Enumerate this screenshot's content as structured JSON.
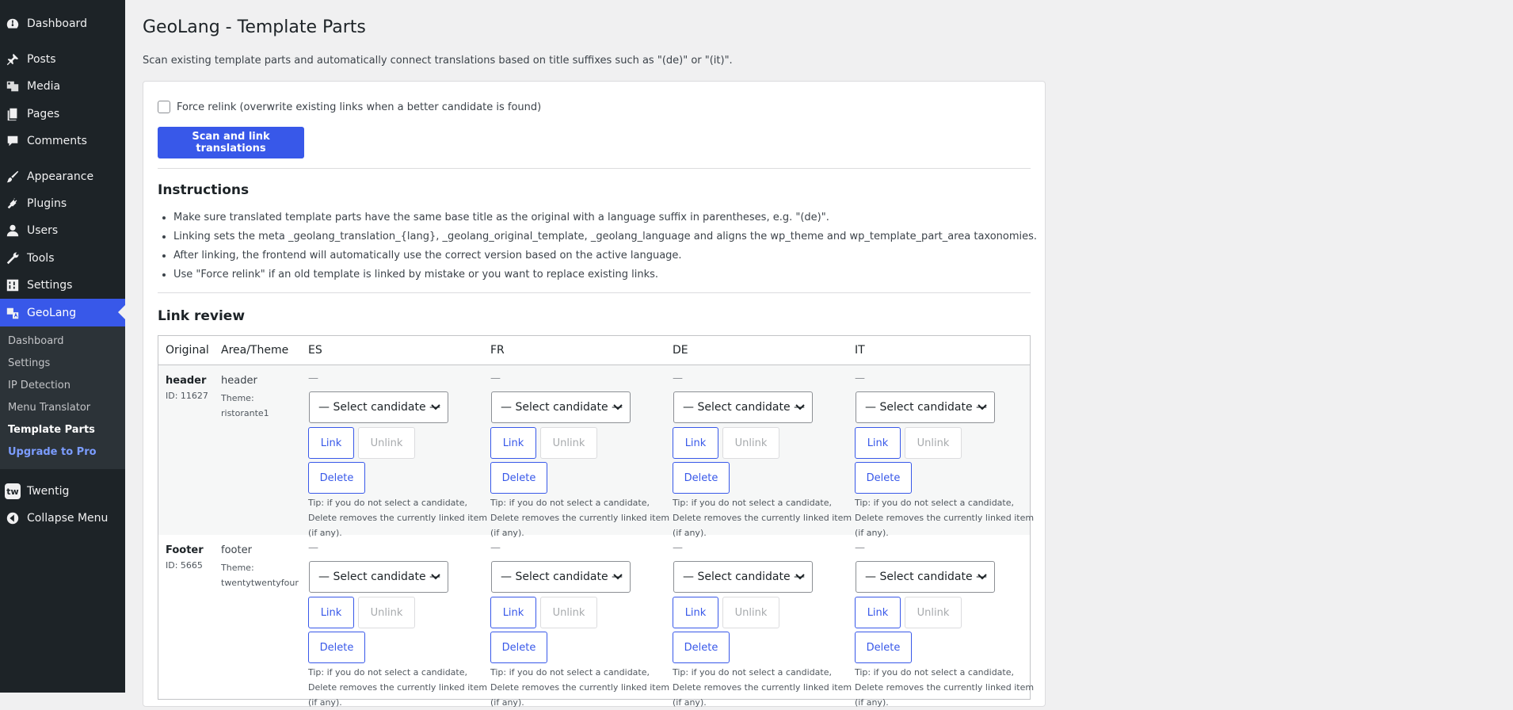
{
  "sidebar": {
    "items": [
      {
        "label": "Dashboard",
        "icon": "dashboard-icon"
      },
      {
        "label": "Posts",
        "icon": "pin-icon"
      },
      {
        "label": "Media",
        "icon": "media-icon"
      },
      {
        "label": "Pages",
        "icon": "pages-icon"
      },
      {
        "label": "Comments",
        "icon": "comment-icon"
      },
      {
        "label": "Appearance",
        "icon": "brush-icon"
      },
      {
        "label": "Plugins",
        "icon": "plug-icon"
      },
      {
        "label": "Users",
        "icon": "user-icon"
      },
      {
        "label": "Tools",
        "icon": "wrench-icon"
      },
      {
        "label": "Settings",
        "icon": "settings-icon"
      },
      {
        "label": "GeoLang",
        "icon": "translate-icon"
      }
    ],
    "submenu": [
      "Dashboard",
      "Settings",
      "IP Detection",
      "Menu Translator",
      "Template Parts",
      "Upgrade to Pro"
    ],
    "twentig": {
      "label": "Twentig",
      "badge": "tw"
    },
    "collapse": "Collapse Menu"
  },
  "page": {
    "title": "GeoLang - Template Parts",
    "description": "Scan existing template parts and automatically connect translations based on title suffixes such as \"(de)\" or \"(it)\"."
  },
  "form": {
    "force_relink_label": "Force relink (overwrite existing links when a better candidate is found)",
    "force_relink_checked": false,
    "scan_button": "Scan and link translations"
  },
  "instructions": {
    "title": "Instructions",
    "items": [
      "Make sure translated template parts have the same base title as the original with a language suffix in parentheses, e.g. \"(de)\".",
      "Linking sets the meta _geolang_translation_{lang}, _geolang_original_template, _geolang_language and aligns the wp_theme and wp_template_part_area taxonomies.",
      "After linking, the frontend will automatically use the correct version based on the active language.",
      "Use \"Force relink\" if an old template is linked by mistake or you want to replace existing links."
    ]
  },
  "review": {
    "title": "Link review",
    "headers": [
      "Original",
      "Area/Theme",
      "ES",
      "FR",
      "DE",
      "IT"
    ],
    "rows": [
      {
        "name": "header",
        "id": "ID: 11627",
        "area": "header",
        "theme": "Theme: ristorante1",
        "langs": [
          {
            "current": "—",
            "select": "— Select candidate —",
            "link": "Link",
            "unlink": "Unlink",
            "delete": "Delete",
            "tip": "Tip: if you do not select a candidate, Delete removes the currently linked item (if any)."
          },
          {
            "current": "—",
            "select": "— Select candidate —",
            "link": "Link",
            "unlink": "Unlink",
            "delete": "Delete",
            "tip": "Tip: if you do not select a candidate, Delete removes the currently linked item (if any)."
          },
          {
            "current": "—",
            "select": "— Select candidate —",
            "link": "Link",
            "unlink": "Unlink",
            "delete": "Delete",
            "tip": "Tip: if you do not select a candidate, Delete removes the currently linked item (if any)."
          },
          {
            "current": "—",
            "select": "— Select candidate —",
            "link": "Link",
            "unlink": "Unlink",
            "delete": "Delete",
            "tip": "Tip: if you do not select a candidate, Delete removes the currently linked item (if any)."
          }
        ]
      },
      {
        "name": "Footer",
        "id": "ID: 5665",
        "area": "footer",
        "theme": "Theme: twentytwentyfour",
        "langs": [
          {
            "current": "—",
            "select": "— Select candidate —",
            "link": "Link",
            "unlink": "Unlink",
            "delete": "Delete",
            "tip": "Tip: if you do not select a candidate, Delete removes the currently linked item (if any)."
          },
          {
            "current": "—",
            "select": "— Select candidate —",
            "link": "Link",
            "unlink": "Unlink",
            "delete": "Delete",
            "tip": "Tip: if you do not select a candidate, Delete removes the currently linked item (if any)."
          },
          {
            "current": "—",
            "select": "— Select candidate —",
            "link": "Link",
            "unlink": "Unlink",
            "delete": "Delete",
            "tip": "Tip: if you do not select a candidate, Delete removes the currently linked item (if any)."
          },
          {
            "current": "—",
            "select": "— Select candidate —",
            "link": "Link",
            "unlink": "Unlink",
            "delete": "Delete",
            "tip": "Tip: if you do not select a candidate, Delete removes the currently linked item (if any)."
          }
        ]
      }
    ]
  },
  "colors": {
    "accent": "#3858e9",
    "sidebar": "#1d2327",
    "submenu": "#2c3338"
  }
}
